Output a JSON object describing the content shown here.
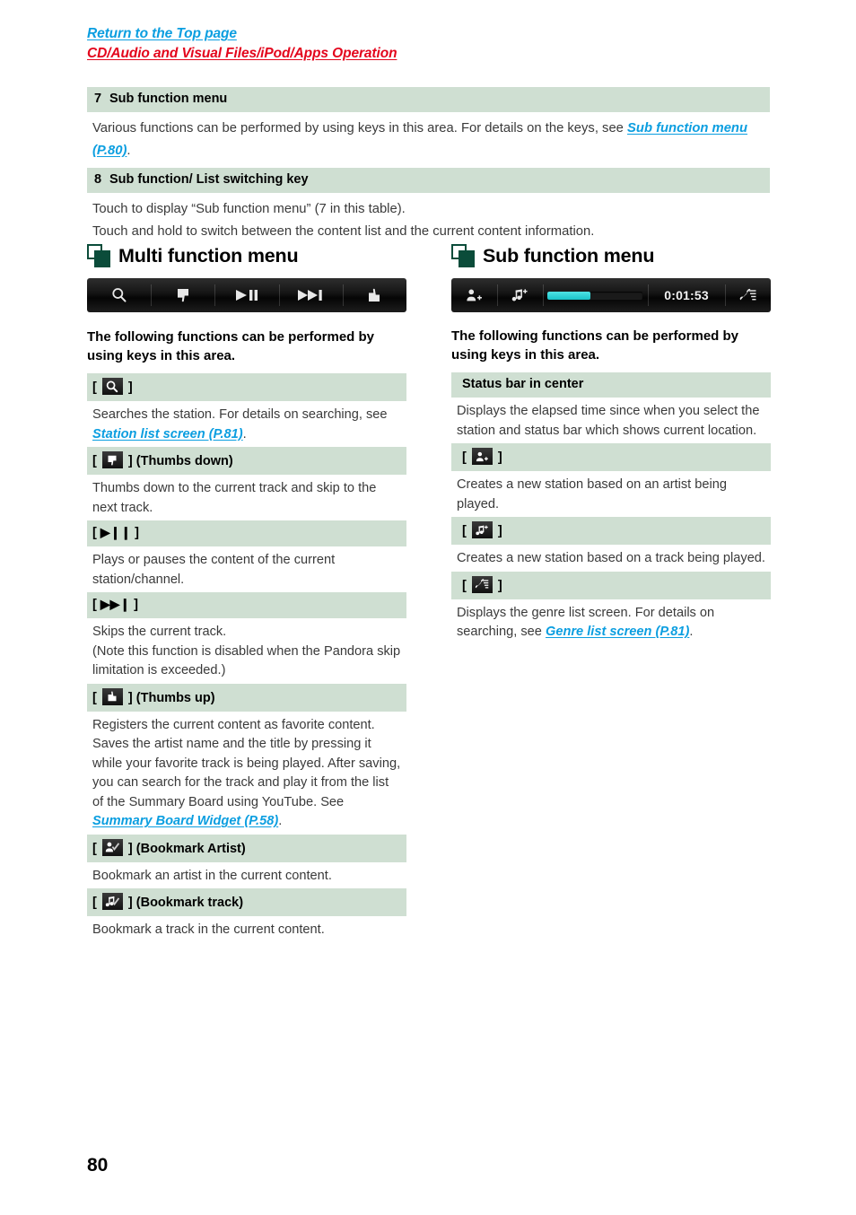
{
  "header": {
    "link_top": "Return to the Top page",
    "link_section": "CD/Audio and Visual Files/iPod/Apps Operation"
  },
  "top_table": [
    {
      "num": "7",
      "title": "Sub function menu",
      "body_pre": "Various functions can be performed by using keys in this area. For details on the keys, see ",
      "body_link": "Sub function menu (P.80)",
      "body_post": "."
    },
    {
      "num": "8",
      "title": "Sub function/ List switching key",
      "line1": "Touch to display “Sub function menu” (7 in this table).",
      "line2": "Touch and hold to switch between the content list and the current content information."
    }
  ],
  "multi_function": {
    "title": "Multi function menu",
    "bar_icons": [
      "search-icon",
      "thumbs-down-icon",
      "play-pause-icon",
      "skip-next-icon",
      "thumbs-up-icon"
    ],
    "lead": "The following functions can be performed by using keys in this area.",
    "items": [
      {
        "icon": "search-icon",
        "label_prefix": "[",
        "label_suffix": "]",
        "label_extra": "",
        "body_pre": "Searches the station. For details on searching, see ",
        "body_link": "Station list screen (P.81)",
        "body_post": "."
      },
      {
        "icon": "thumbs-down-icon",
        "label_prefix": "[",
        "label_suffix": "]",
        "label_extra": " (Thumbs down)",
        "body_pre": "Thumbs down to the current track and skip to the next track.",
        "body_link": "",
        "body_post": ""
      },
      {
        "icon": "play-pause-glyph",
        "glyph": "▶❙❙",
        "label_prefix": "[",
        "label_suffix": "]",
        "label_extra": "",
        "body_pre": "Plays or pauses the content of the current station/channel.",
        "body_link": "",
        "body_post": ""
      },
      {
        "icon": "skip-next-glyph",
        "glyph": "▶▶❙",
        "label_prefix": "[",
        "label_suffix": "]",
        "label_extra": "",
        "body_line1": "Skips the current track.",
        "body_line2": "(Note this function is disabled when the Pandora skip limitation is exceeded.)"
      },
      {
        "icon": "thumbs-up-icon",
        "label_prefix": "[",
        "label_suffix": "]",
        "label_extra": " (Thumbs up)",
        "body_line1": "Registers the current content as favorite content.",
        "body_line2_pre": "Saves the artist name and the title by pressing it while your favorite track is being played. After saving, you can search for the track and play it from the list of the Summary Board using YouTube. See ",
        "body_line2_link": "Summary Board Widget (P.58)",
        "body_line2_post": "."
      },
      {
        "icon": "bookmark-artist-icon",
        "label_prefix": "[",
        "label_suffix": "]",
        "label_extra": " (Bookmark Artist)",
        "body_pre": "Bookmark an artist in the current content.",
        "body_link": "",
        "body_post": ""
      },
      {
        "icon": "bookmark-track-icon",
        "label_prefix": "[",
        "label_suffix": "]",
        "label_extra": " (Bookmark track)",
        "body_pre": "Bookmark a track in the current content.",
        "body_link": "",
        "body_post": ""
      }
    ]
  },
  "sub_function": {
    "title": "Sub function menu",
    "bar": {
      "icons": [
        "add-artist-station-icon",
        "add-track-station-icon",
        "genre-list-icon"
      ],
      "time": "0:01:53",
      "progress_percent": 45,
      "progress_color": "#2bd4d4"
    },
    "lead": "The following functions can be performed by using keys in this area.",
    "items": [
      {
        "type": "text-head",
        "head": "Status bar in center",
        "body_pre": "Displays the elapsed time since when you select the station and status bar which shows current location.",
        "body_link": "",
        "body_post": ""
      },
      {
        "type": "icon-head",
        "icon": "add-artist-station-icon",
        "label_prefix": "[",
        "label_suffix": "]",
        "body_pre": "Creates a new station based on an artist being played.",
        "body_link": "",
        "body_post": ""
      },
      {
        "type": "icon-head",
        "icon": "add-track-station-icon",
        "label_prefix": "[",
        "label_suffix": "]",
        "body_pre": "Creates a new station based on a track being played.",
        "body_link": "",
        "body_post": ""
      },
      {
        "type": "icon-head",
        "icon": "genre-list-icon",
        "label_prefix": "[",
        "label_suffix": "]",
        "body_pre": "Displays the genre list screen. For details on searching, see ",
        "body_link": "Genre list screen (P.81)",
        "body_post": "."
      }
    ]
  },
  "footer": {
    "page_number": "80"
  },
  "colors": {
    "band_green": "#cfdfd2",
    "link_blue": "#0b9ee0",
    "link_red": "#e3051c",
    "marker_green": "#0b4c3a",
    "progress_cyan": "#2bd4d4"
  }
}
